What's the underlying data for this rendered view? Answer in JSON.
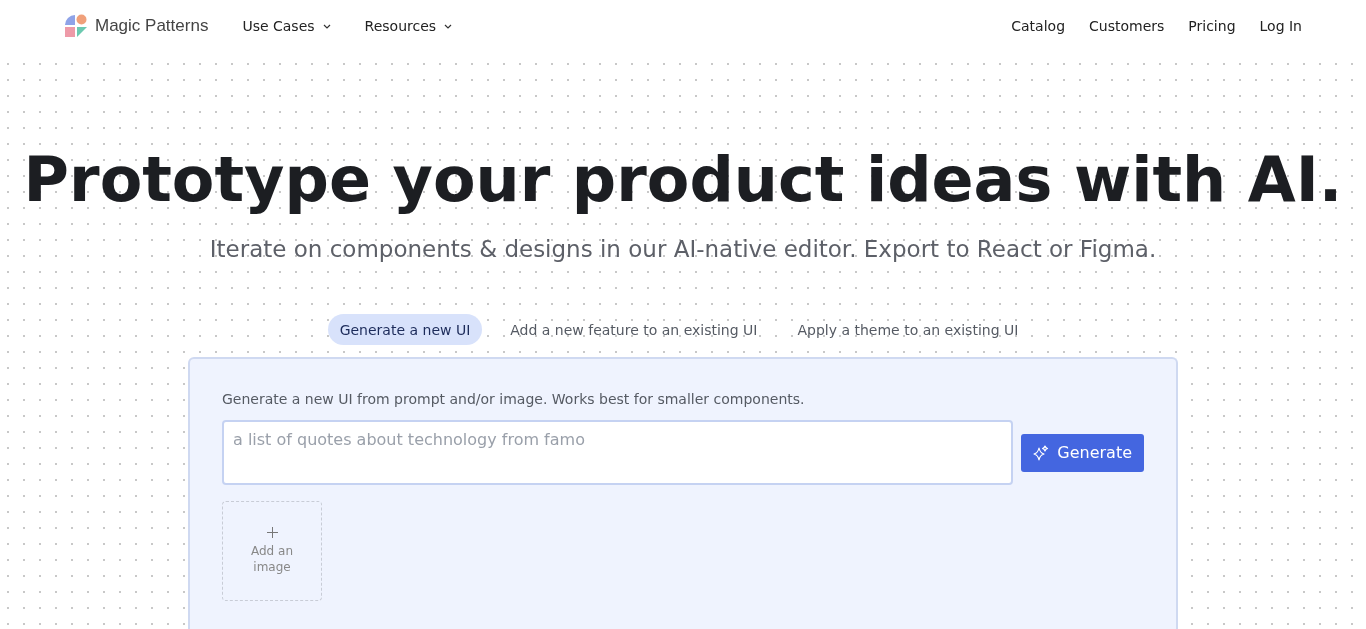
{
  "nav": {
    "brand": "Magic Patterns",
    "menus": [
      {
        "label": "Use Cases"
      },
      {
        "label": "Resources"
      }
    ],
    "links": [
      "Catalog",
      "Customers",
      "Pricing",
      "Log In"
    ]
  },
  "hero": {
    "title": "Prototype your product ideas with AI.",
    "subtitle": "Iterate on components & designs in our AI-native editor. Export to React or Figma."
  },
  "tabs": [
    {
      "label": "Generate a new UI",
      "selected": true
    },
    {
      "label": "Add a new feature to an existing UI",
      "selected": false
    },
    {
      "label": "Apply a theme to an existing UI",
      "selected": false
    }
  ],
  "panel": {
    "description": "Generate a new UI from prompt and/or image. Works best for smaller components.",
    "prompt": {
      "placeholder": "a list of quotes about technology from famo"
    },
    "generate_button": "Generate",
    "image_upload": "Add an image"
  }
}
